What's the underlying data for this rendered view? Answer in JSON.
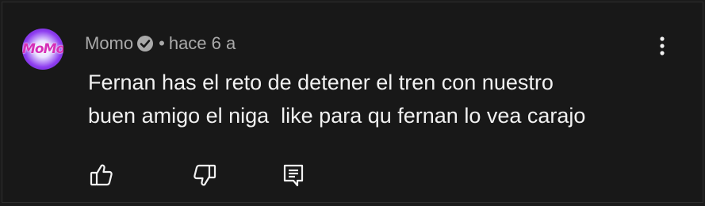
{
  "comment": {
    "author": "Momo",
    "separator": "•",
    "time": "hace 6 a",
    "avatar_text": "MoMo",
    "text_lines": [
      "Fernan has el reto de detener el tren con nuestro",
      "buen amigo el niga  like para qu fernan lo vea carajo"
    ]
  },
  "icons": {
    "verified": "verified-badge-icon",
    "menu": "more-vertical-icon",
    "like": "thumbs-up-icon",
    "dislike": "thumbs-down-icon",
    "reply": "reply-comment-icon"
  },
  "colors": {
    "background": "#181818",
    "text": "#f1f1f1",
    "meta": "#aaaaaa",
    "avatar_accent": "#8e3df0"
  }
}
